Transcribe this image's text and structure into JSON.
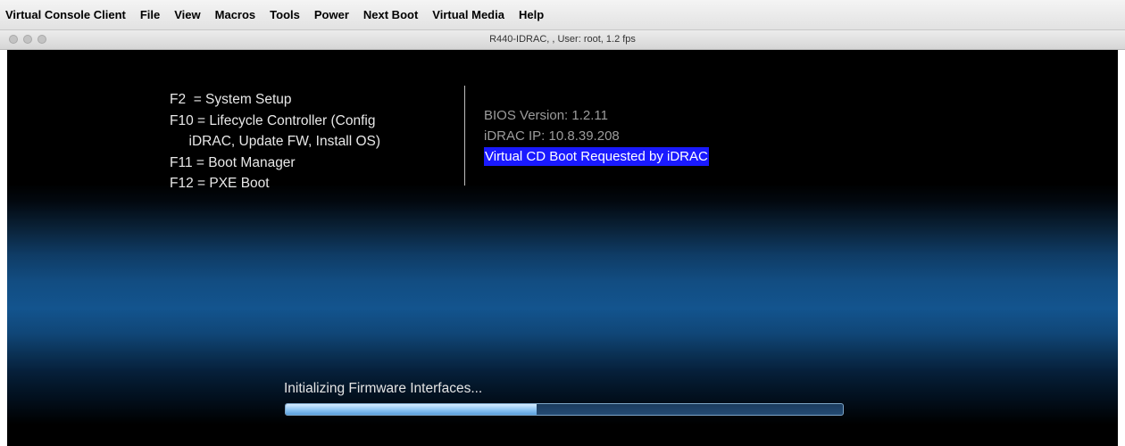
{
  "menubar": {
    "app_name": "Virtual Console Client",
    "items": [
      "File",
      "View",
      "Macros",
      "Tools",
      "Power",
      "Next Boot",
      "Virtual Media",
      "Help"
    ]
  },
  "window": {
    "title": "R440-IDRAC,  , User: root, 1.2 fps"
  },
  "console": {
    "hotkeys": [
      "F2  = System Setup",
      "F10 = Lifecycle Controller (Config",
      "     iDRAC, Update FW, Install OS)",
      "F11 = Boot Manager",
      "F12 = PXE Boot"
    ],
    "bios_version": "BIOS Version: 1.2.11",
    "idrac_ip": "iDRAC IP:  10.8.39.208",
    "boot_notice": "Virtual CD Boot Requested by iDRAC",
    "progress_label": "Initializing Firmware Interfaces...",
    "progress_fraction": 0.45
  },
  "colors": {
    "highlight": "#1a1aff",
    "progress_fill": "#8bc3f2"
  }
}
